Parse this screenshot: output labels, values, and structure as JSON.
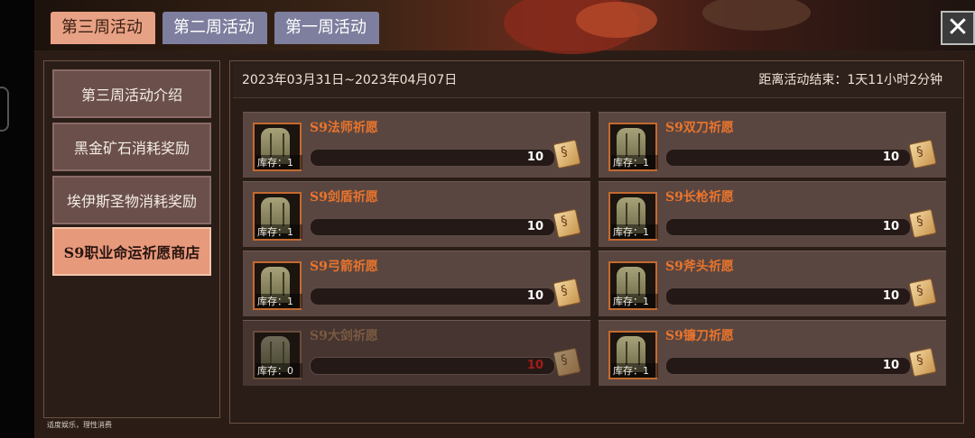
{
  "tabs": [
    {
      "label": "第三周活动",
      "active": true
    },
    {
      "label": "第二周活动",
      "active": false
    },
    {
      "label": "第一周活动",
      "active": false
    }
  ],
  "close_label": "✕",
  "left_nav": [
    {
      "label": "第三周活动介绍",
      "active": false
    },
    {
      "label": "黑金矿石消耗奖励",
      "active": false
    },
    {
      "label": "埃伊斯圣物消耗奖励",
      "active": false
    },
    {
      "label": "S9职业命运祈愿商店",
      "active": true
    }
  ],
  "footnote": "适度娱乐，理性消费",
  "header": {
    "date_range": "2023年03月31日~2023年04月07日",
    "countdown": "距离活动结束：1天11小时2分钟"
  },
  "items": [
    {
      "name": "S9法师祈愿",
      "stock": "库存：1",
      "price": "10",
      "available": true
    },
    {
      "name": "S9双刀祈愿",
      "stock": "库存：1",
      "price": "10",
      "available": true
    },
    {
      "name": "S9剑盾祈愿",
      "stock": "库存：1",
      "price": "10",
      "available": true
    },
    {
      "name": "S9长枪祈愿",
      "stock": "库存：1",
      "price": "10",
      "available": true
    },
    {
      "name": "S9弓箭祈愿",
      "stock": "库存：1",
      "price": "10",
      "available": true
    },
    {
      "name": "S9斧头祈愿",
      "stock": "库存：1",
      "price": "10",
      "available": true
    },
    {
      "name": "S9大剑祈愿",
      "stock": "库存：0",
      "price": "10",
      "available": false
    },
    {
      "name": "S9镰刀祈愿",
      "stock": "库存：1",
      "price": "10",
      "available": true
    }
  ],
  "colors": {
    "panel_bg": "#2b1d16",
    "tab_active": "#e7a184",
    "tab_inactive": "#7e7e9e",
    "item_name": "#e8742d",
    "price_disabled": "#a31b1b"
  }
}
